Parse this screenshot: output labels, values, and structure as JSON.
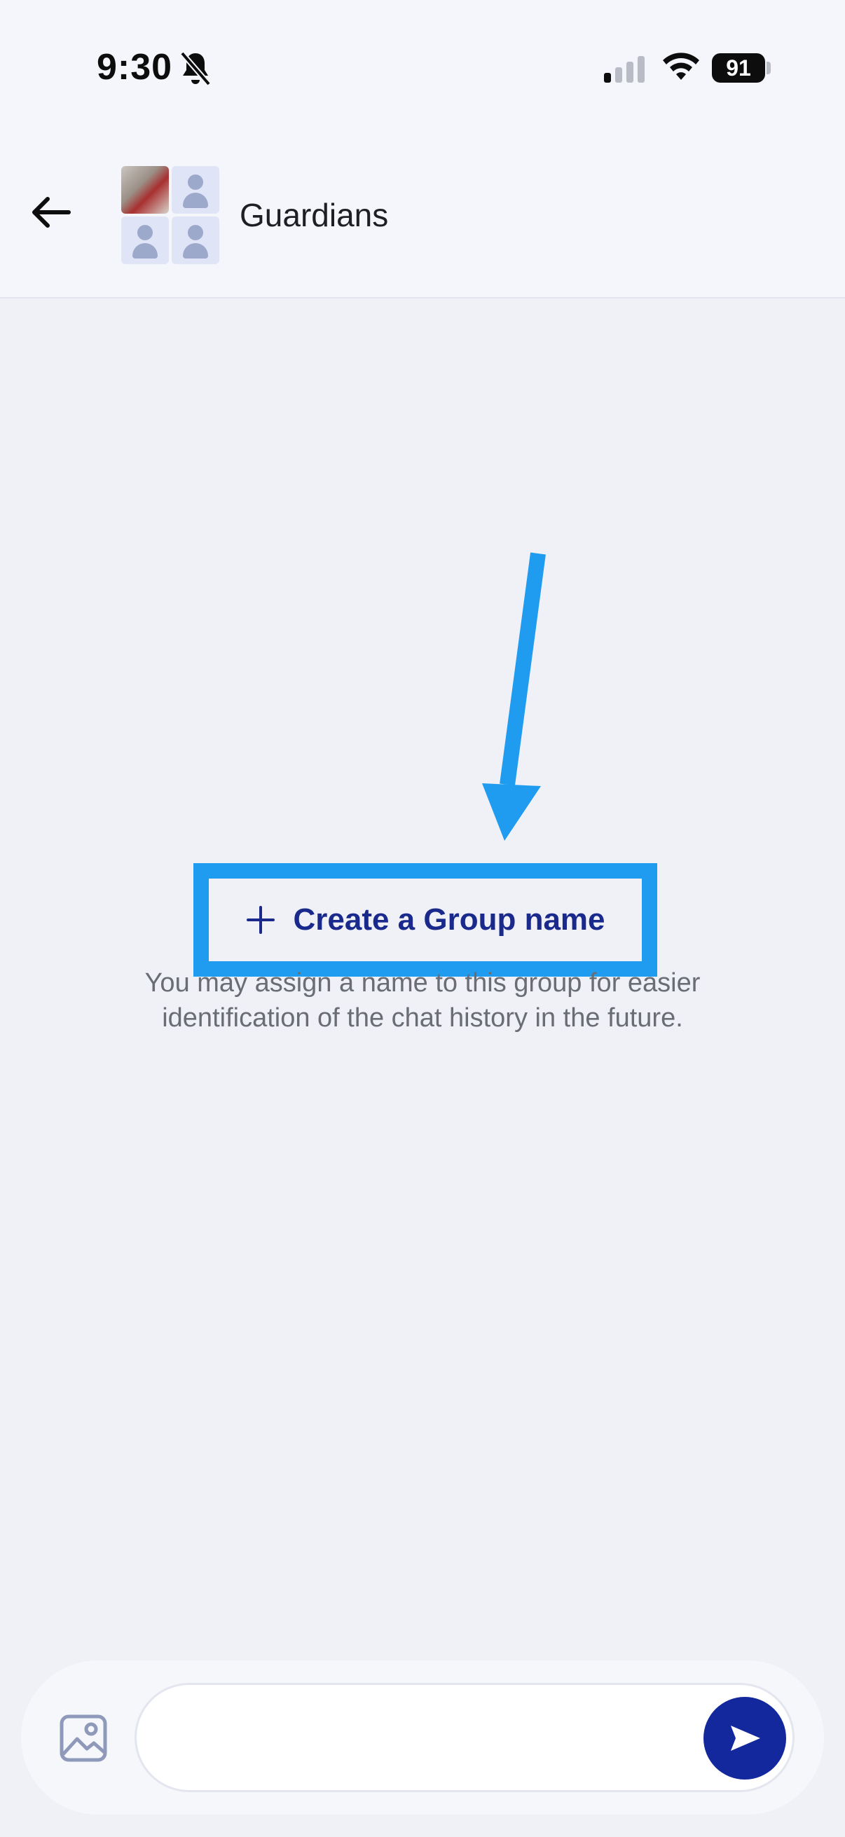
{
  "status_bar": {
    "time": "9:30",
    "battery": "91",
    "icons": [
      "bell-slash-icon",
      "signal-icon",
      "wifi-icon",
      "battery-icon"
    ]
  },
  "header": {
    "title": "Guardians",
    "back_icon": "arrow-left-icon"
  },
  "main": {
    "create_group_label": "Create a Group name",
    "hint": "You may assign a name to this group for easier identification of the chat history in the future."
  },
  "composer": {
    "placeholder": "",
    "image_icon": "image-icon",
    "send_icon": "send-icon"
  },
  "colors": {
    "accent": "#13289c",
    "highlight": "#1f9cf0",
    "background": "#eff1f7"
  }
}
